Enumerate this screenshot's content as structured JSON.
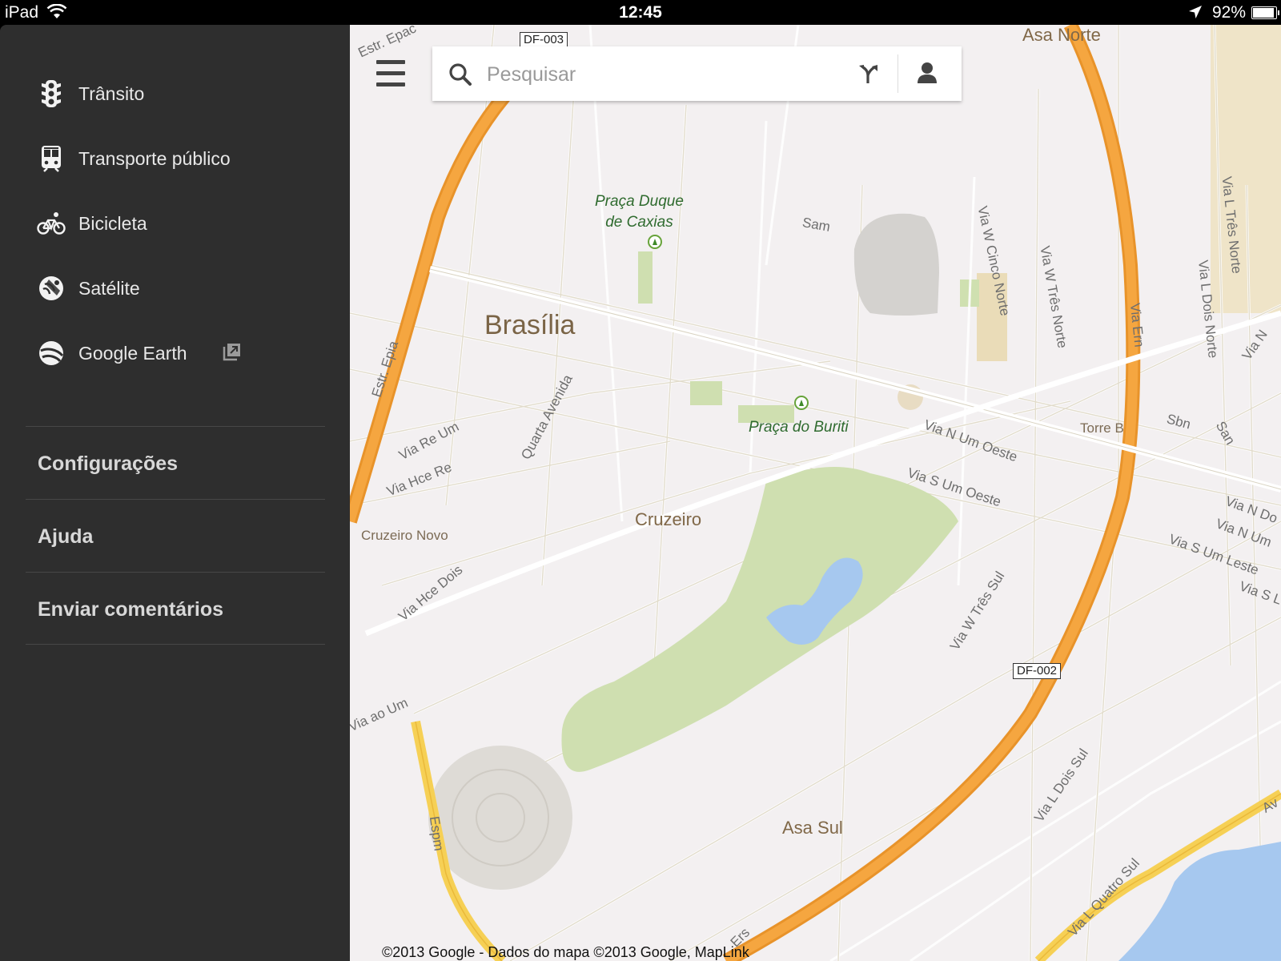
{
  "status_bar": {
    "carrier": "iPad",
    "time": "12:45",
    "battery": "92%",
    "battery_level": 0.92
  },
  "drawer": {
    "layers": [
      {
        "label": "Trânsito",
        "icon": "traffic-light-icon"
      },
      {
        "label": "Transporte público",
        "icon": "transit-icon"
      },
      {
        "label": "Bicicleta",
        "icon": "bicycle-icon"
      },
      {
        "label": "Satélite",
        "icon": "satellite-icon"
      },
      {
        "label": "Google Earth",
        "icon": "google-earth-icon",
        "external_icon": "open-external-icon"
      }
    ],
    "links": [
      "Configurações",
      "Ajuda",
      "Enviar comentários"
    ]
  },
  "search": {
    "placeholder": "Pesquisar",
    "value": ""
  },
  "map": {
    "labels": {
      "city": "Brasília",
      "asa_norte": "Asa Norte",
      "asa_sul": "Asa Sul",
      "cruzeiro": "Cruzeiro",
      "cruzeiro_novo": "Cruzeiro Novo",
      "torre_b": "Torre B",
      "praca_duque": "Praça Duque\nde Caxias",
      "praca_buriti": "Praça do Buriti"
    },
    "streets": {
      "epac": "Estr. Epac",
      "estr_epia": "Estr. Epia",
      "via_re_um": "Via Re Um",
      "via_hce_re": "Via Hce Re",
      "quarta_avenida": "Quarta Avenida",
      "via_hce_dois": "Via Hce Dois",
      "via_ao_um": "Via ao Um",
      "espm": "Espm",
      "sam": "Sam",
      "via_w_cinco_norte": "Via W Cinco Norte",
      "via_w_tres_norte": "Via W Três Norte",
      "via_ern": "Via Ern",
      "via_l_tres_norte": "Via L Três Norte",
      "via_l_dois_norte": "Via L Dois Norte",
      "via_n": "Via N",
      "via_n_um_oeste": "Via N Um Oeste",
      "via_s_um_oeste": "Via S Um Oeste",
      "sbn": "Sbn",
      "san": "San",
      "via_n_dois": "Via N Do",
      "via_n_um": "Via N Um",
      "via_s_um_leste": "Via S Um Leste",
      "via_s_l": "Via S L",
      "via_w_tres_sul": "Via W Três Sul",
      "via_l_dois_sul": "Via L Dois Sul",
      "via_l_quatro_sul": "Via L Quatro Sul",
      "ers": "Ers",
      "av": "Av"
    },
    "shields": [
      "DF-003",
      "DF-002"
    ],
    "copyright": "©2013 Google - Dados do mapa ©2013 Google, MapLink"
  }
}
